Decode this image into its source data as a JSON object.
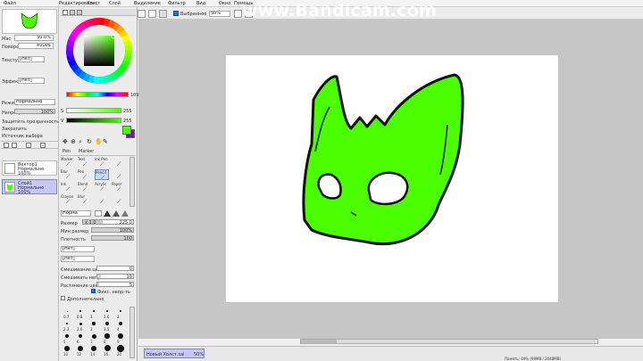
{
  "menubar": {
    "items": [
      "Файл",
      "Редактировать",
      "Холст",
      "Слой",
      "Выделение",
      "Фильтр",
      "Вид",
      "Окно",
      "Помощь",
      "Выбранное"
    ]
  },
  "watermark": "www.Bandicam.com",
  "toolbar": {
    "selection_label": "Выбранное",
    "zoom_value": "50%"
  },
  "navigator": {
    "zoom_label": "Мас",
    "zoom_value": "50.0%",
    "angle_label": "Поворот",
    "angle_value": "+000$"
  },
  "left_settings": {
    "texture_label": "Текстура",
    "texture_value": "[Нет]",
    "effect_label": "Эффект края",
    "effect_value": "[Нет]",
    "mode_label": "Режим",
    "mode_value": "Нормально",
    "opacity_label": "Непрозрачность",
    "opacity_value": "100%",
    "opacity_level": 1.0,
    "check1": "Защитить прозрачность",
    "check2": "Закрепить",
    "check3": "Источник выбора"
  },
  "layers": [
    {
      "name": "Вектор1",
      "mode": "Нормально",
      "opacity": "100%",
      "selected": false
    },
    {
      "name": "Слой1",
      "mode": "Нормально",
      "opacity": "100%",
      "selected": true
    }
  ],
  "color": {
    "current": "#4cff00",
    "secondary": "#9400d3",
    "h_label": "H",
    "h_value": "109",
    "s_label": "S",
    "s_value": "255",
    "v_label": "V",
    "v_value": "255"
  },
  "tools": {
    "tabs": [
      "Pen",
      "Marker"
    ],
    "brushes": [
      {
        "label": "Marker"
      },
      {
        "label": "Text"
      },
      {
        "label": "Ink Pen"
      },
      {
        "label": ""
      },
      {
        "label": "Blur"
      },
      {
        "label": "Pen"
      },
      {
        "label": "Pencil"
      },
      {
        "label": ""
      },
      {
        "label": "Ink"
      },
      {
        "label": "Blend"
      },
      {
        "label": "Acrylic"
      },
      {
        "label": "Paper"
      },
      {
        "label": "Crayon"
      },
      {
        "label": "Blur"
      },
      {
        "label": ""
      },
      {
        "label": ""
      }
    ]
  },
  "brush_settings": {
    "mode_value": "Норма",
    "size_label": "Размер",
    "size_mult": "x 1.0",
    "size_value": "225.0",
    "minsize_label": "Мин размер",
    "minsize_value": "100%",
    "density_label": "Плотность",
    "density_value": "100",
    "shape_value": "[Нет]",
    "texture_value": "[Нет]",
    "blend_label": "Смешивание цвет",
    "blend_value": "0",
    "dilution_label": "Смешивать непр",
    "dilution_value": "10",
    "persistence_label": "Растянение цвет",
    "persistence_value": "5",
    "keep_opacity": "Фикс. непр-ть",
    "advanced": "Дополнительно"
  },
  "brush_sizes": [
    "0.7",
    "0.8",
    "1",
    "1.6",
    "2",
    "2.3",
    "2.6",
    "3",
    "3.5",
    "4",
    "5",
    "6",
    "7",
    "8",
    "9",
    "10",
    "12",
    "14",
    "16",
    "20"
  ],
  "status": {
    "document": "Новый Холст.sai",
    "document_zoom": "50%",
    "memory": "Память: 44% (99MB / 2048MB)"
  },
  "drawing": {
    "fill_color": "#4cff00",
    "line_color": "#111111"
  }
}
